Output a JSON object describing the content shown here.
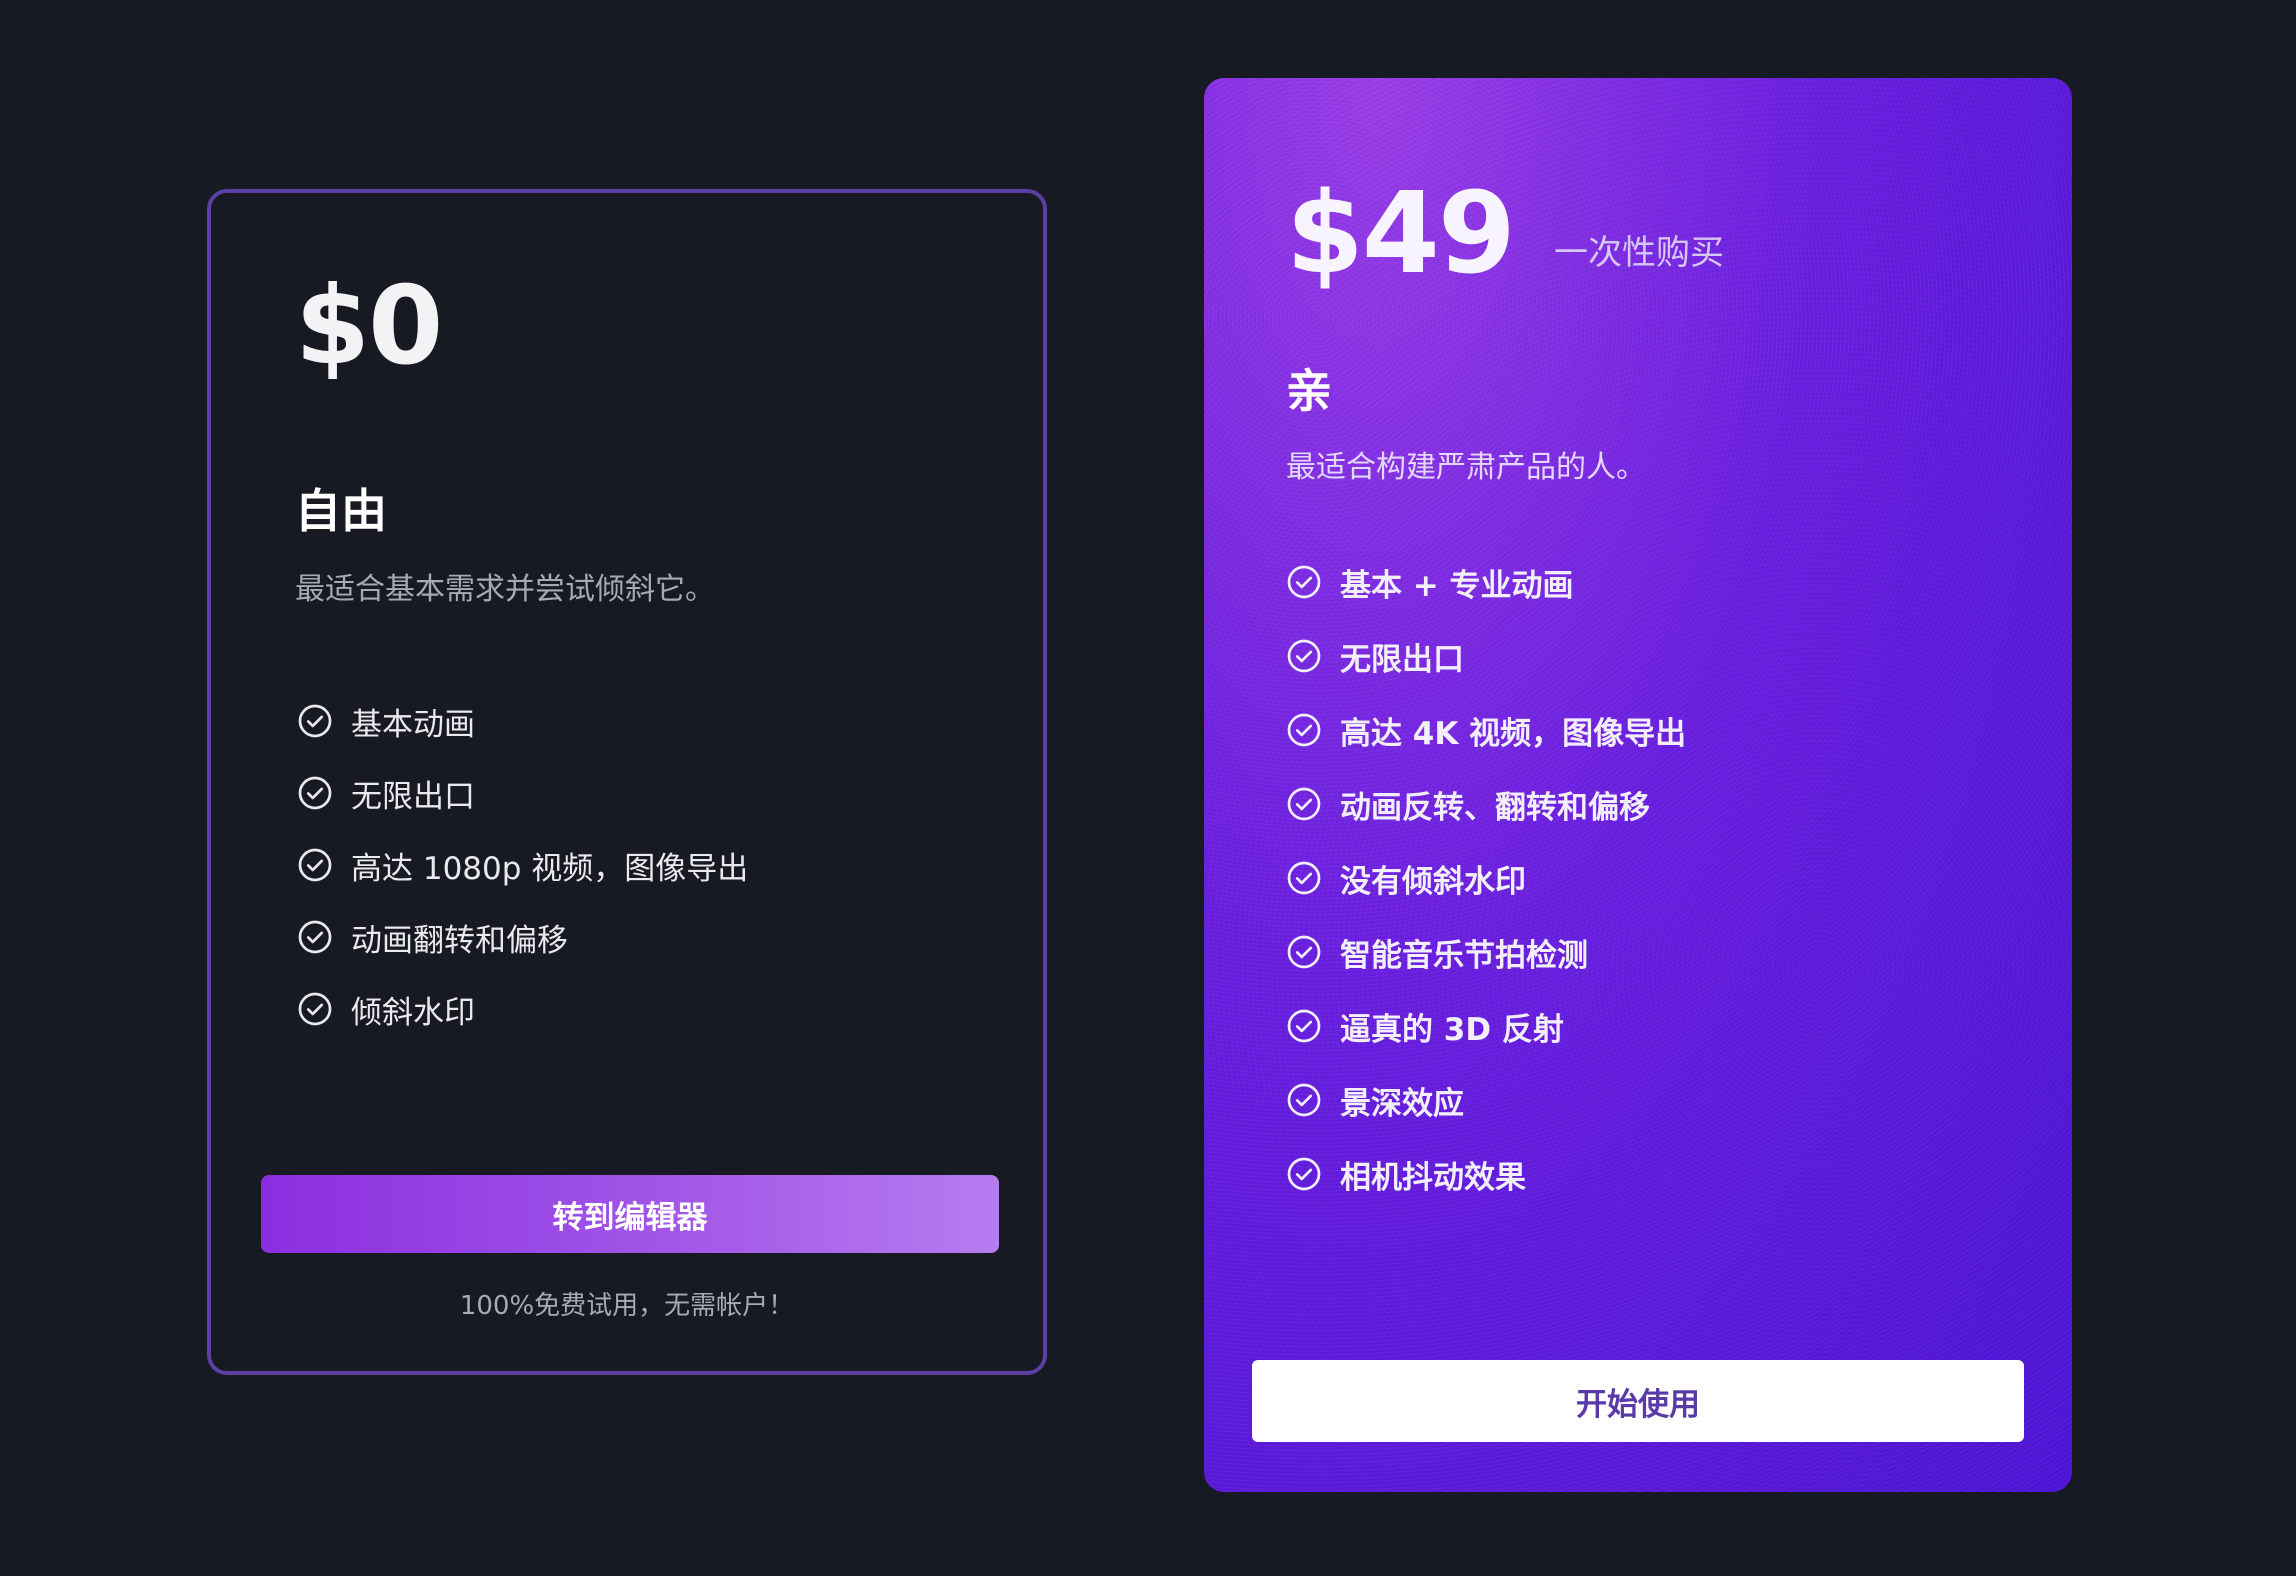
{
  "colors": {
    "background": "#171a23",
    "free_border": "#5b3fa3",
    "pro_gradient_start": "#9a3ee8",
    "pro_gradient_end": "#4d15d6",
    "accent_button": "#a45ae8",
    "start_button_text": "#5a3aa8"
  },
  "icons": {
    "feature": "check-circle-icon"
  },
  "free_plan": {
    "price": "$0",
    "name": "自由",
    "description": "最适合基本需求并尝试倾斜它。",
    "features": [
      "基本动画",
      "无限出口",
      "高达 1080p 视频，图像导出",
      "动画翻转和偏移",
      "倾斜水印"
    ],
    "button_label": "转到编辑器",
    "note": "100%免费试用，无需帐户！"
  },
  "pro_plan": {
    "price": "$49",
    "price_suffix": "一次性购买",
    "name": "亲",
    "description": "最适合构建严肃产品的人。",
    "features": [
      "基本 + 专业动画",
      "无限出口",
      "高达 4K 视频，图像导出",
      "动画反转、翻转和偏移",
      "没有倾斜水印",
      "智能音乐节拍检测",
      "逼真的 3D 反射",
      "景深效应",
      "相机抖动效果"
    ],
    "button_label": "开始使用"
  }
}
